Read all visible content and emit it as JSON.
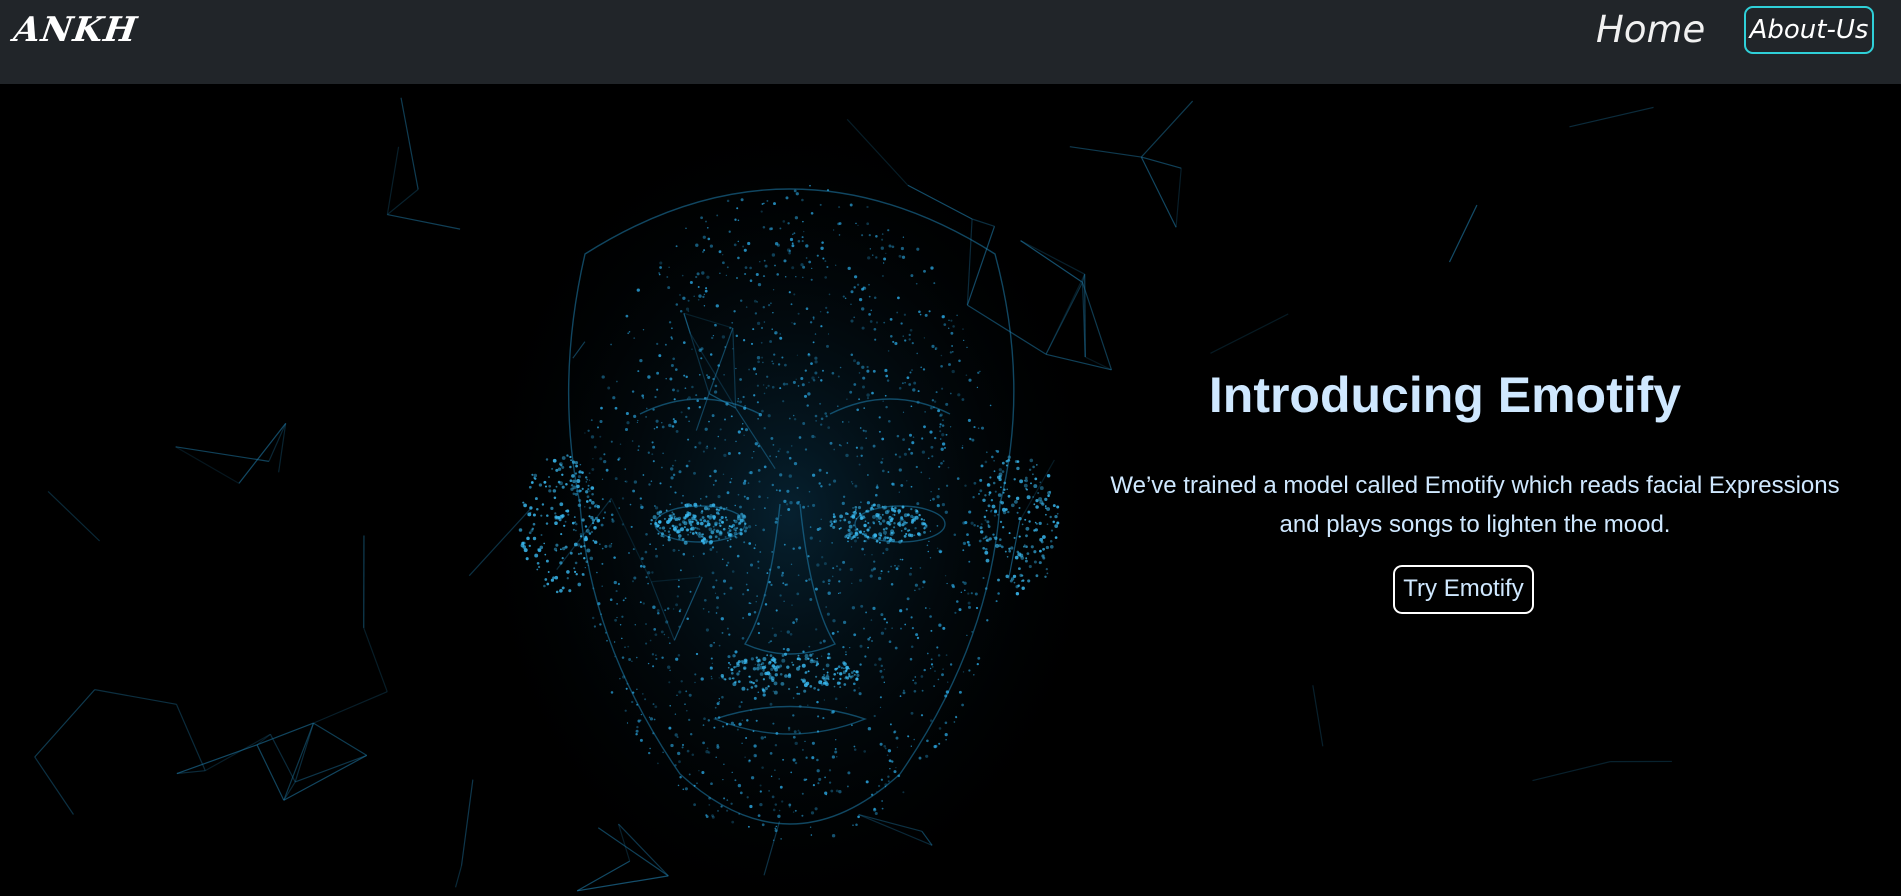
{
  "navbar": {
    "brand": "ANKH",
    "home_label": "Home",
    "about_label": "About-Us"
  },
  "hero": {
    "title": "Introducing Emotify",
    "description": "We’ve trained a model called Emotify which reads facial Expressions and plays songs to lighten the mood.",
    "cta_label": "Try Emotify",
    "background_image": "wireframe-face-illustration"
  },
  "colors": {
    "navbar_bg": "#212529",
    "hero_bg": "#000000",
    "accent_border": "#2fd0d8",
    "text_light": "#cfe8ff",
    "particle_blue": "#1e8fc2"
  }
}
